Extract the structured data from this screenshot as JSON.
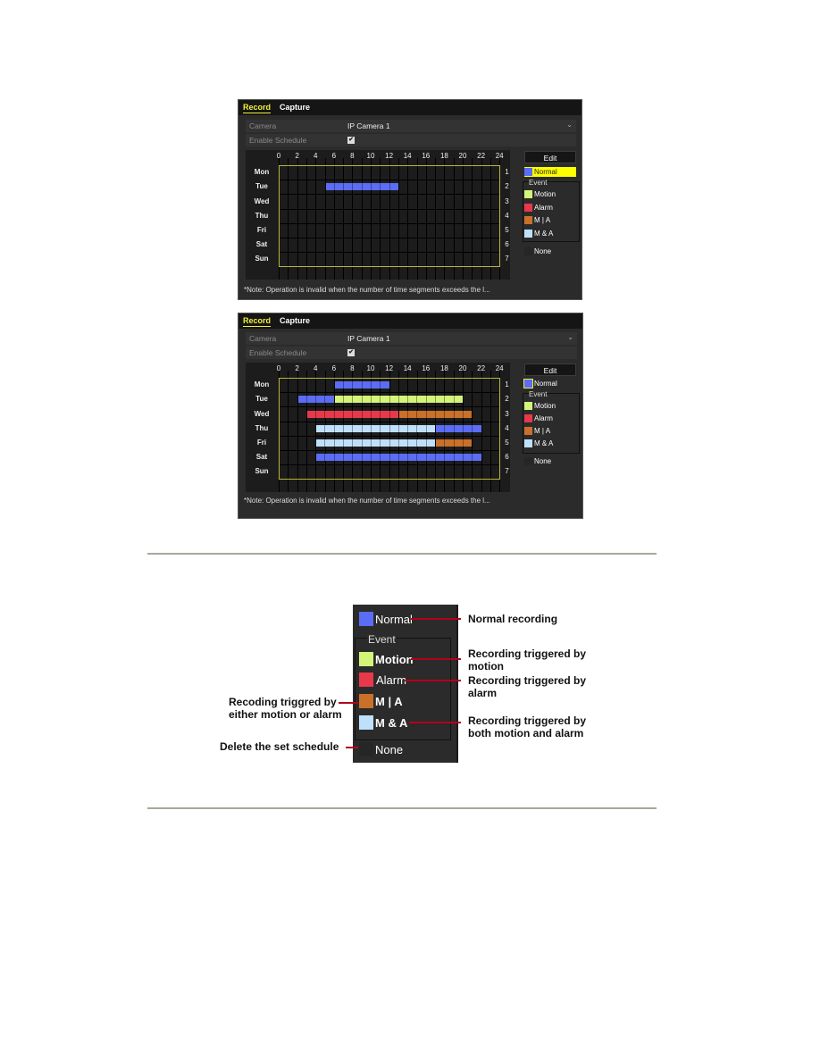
{
  "screens": [
    {
      "tabs": [
        {
          "label": "Record",
          "active": true
        },
        {
          "label": "Capture",
          "active": false
        }
      ],
      "camera_label": "Camera",
      "camera_value": "IP Camera 1",
      "enable_label": "Enable Schedule",
      "enable_checked": true,
      "check_glyph": "✔",
      "hours": [
        "0",
        "2",
        "4",
        "6",
        "8",
        "10",
        "12",
        "14",
        "16",
        "18",
        "20",
        "22",
        "24"
      ],
      "days": [
        "Mon",
        "Tue",
        "Wed",
        "Thu",
        "Fri",
        "Sat",
        "Sun"
      ],
      "day_numbers": [
        "1",
        "2",
        "3",
        "4",
        "5",
        "6",
        "7"
      ],
      "schedule": [
        {
          "day": "Tue",
          "type": "normal",
          "start": 5,
          "end": 13
        }
      ],
      "edit_label": "Edit",
      "legend_normal_label": "Normal",
      "legend_normal_selected": true,
      "event_title": "Event",
      "legend_items": [
        {
          "type": "motion",
          "label": "Motion"
        },
        {
          "type": "alarm",
          "label": "Alarm"
        },
        {
          "type": "m_or_a",
          "label": "M | A"
        },
        {
          "type": "m_and_a",
          "label": "M & A"
        }
      ],
      "none_label": "None",
      "note": "*Note: Operation is invalid when the number of time segments exceeds the l..."
    },
    {
      "tabs": [
        {
          "label": "Record",
          "active": true
        },
        {
          "label": "Capture",
          "active": false
        }
      ],
      "camera_label": "Camera",
      "camera_value": "IP Camera 1",
      "enable_label": "Enable Schedule",
      "enable_checked": true,
      "check_glyph": "✔",
      "hours": [
        "0",
        "2",
        "4",
        "6",
        "8",
        "10",
        "12",
        "14",
        "16",
        "18",
        "20",
        "22",
        "24"
      ],
      "days": [
        "Mon",
        "Tue",
        "Wed",
        "Thu",
        "Fri",
        "Sat",
        "Sun"
      ],
      "day_numbers": [
        "1",
        "2",
        "3",
        "4",
        "5",
        "6",
        "7"
      ],
      "schedule": [
        {
          "day": "Mon",
          "type": "normal",
          "start": 6,
          "end": 12
        },
        {
          "day": "Tue",
          "type": "normal",
          "start": 2,
          "end": 6
        },
        {
          "day": "Tue",
          "type": "motion",
          "start": 6,
          "end": 20
        },
        {
          "day": "Wed",
          "type": "alarm",
          "start": 3,
          "end": 13
        },
        {
          "day": "Wed",
          "type": "m_or_a",
          "start": 13,
          "end": 21
        },
        {
          "day": "Thu",
          "type": "m_and_a",
          "start": 4,
          "end": 17
        },
        {
          "day": "Thu",
          "type": "normal",
          "start": 17,
          "end": 22
        },
        {
          "day": "Fri",
          "type": "m_and_a",
          "start": 4,
          "end": 17
        },
        {
          "day": "Fri",
          "type": "m_or_a",
          "start": 17,
          "end": 21
        },
        {
          "day": "Sat",
          "type": "normal",
          "start": 4,
          "end": 22
        }
      ],
      "edit_label": "Edit",
      "legend_normal_label": "Normal",
      "legend_normal_selected": false,
      "event_title": "Event",
      "legend_items": [
        {
          "type": "motion",
          "label": "Motion"
        },
        {
          "type": "alarm",
          "label": "Alarm"
        },
        {
          "type": "m_or_a",
          "label": "M | A"
        },
        {
          "type": "m_and_a",
          "label": "M & A"
        }
      ],
      "none_label": "None",
      "note": "*Note: Operation is invalid when the number of time segments exceeds the l..."
    }
  ],
  "colors": {
    "normal": "#5b6cf5",
    "motion": "#d4f57a",
    "alarm": "#e8394a",
    "m_or_a": "#c9702a",
    "m_and_a": "#bfe0fb",
    "none": "#262626",
    "accent": "#f2ef3c",
    "annotation_line": "#b3001b"
  },
  "legend_diagram": {
    "normal_label": "Normal",
    "event_title": "Event",
    "motion_label": "Motion",
    "alarm_label": "Alarm",
    "m_or_a_label": "M | A",
    "m_and_a_label": "M & A",
    "none_label": "None",
    "annotations": {
      "normal": "Normal recording",
      "motion": "Recording triggered by\nmotion",
      "alarm": "Recording triggered by\nalarm",
      "m_or_a": "Recoding triggred by\neither motion or alarm",
      "m_and_a": "Recording triggered by\nboth motion and alarm",
      "none": "Delete the set schedule"
    }
  }
}
